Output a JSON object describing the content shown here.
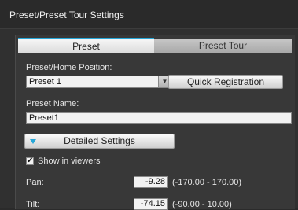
{
  "window": {
    "title": "Preset/Preset Tour Settings"
  },
  "tabs": [
    {
      "label": "Preset",
      "active": true
    },
    {
      "label": "Preset Tour",
      "active": false
    }
  ],
  "preset_home": {
    "label": "Preset/Home Position:",
    "selected": "Preset 1",
    "quick_registration_label": "Quick Registration"
  },
  "preset_name": {
    "label": "Preset Name:",
    "value": "Preset1"
  },
  "detailed_settings_label": "Detailed Settings",
  "show_in_viewers": {
    "label": "Show in viewers",
    "checked": true
  },
  "pan": {
    "label": "Pan:",
    "value": "-9.28",
    "range": "(-170.00 - 170.00)"
  },
  "tilt": {
    "label": "Tilt:",
    "value": "-74.15",
    "range": "(-90.00 - 10.00)"
  },
  "colors": {
    "accent": "#27a7d8",
    "background": "#303030"
  }
}
